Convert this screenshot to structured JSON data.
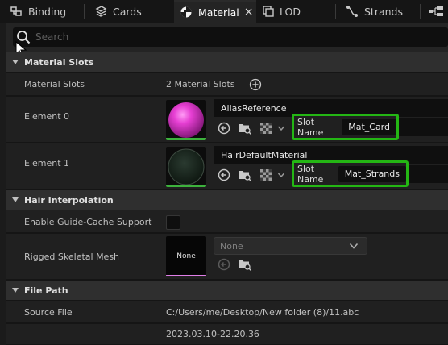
{
  "tabs": [
    {
      "label": "Binding",
      "icon": "binding-icon",
      "active": false
    },
    {
      "label": "Cards",
      "icon": "cards-icon",
      "active": false
    },
    {
      "label": "Material",
      "icon": "material-icon",
      "active": true,
      "close": "×"
    },
    {
      "label": "LOD",
      "icon": "lod-icon",
      "active": false
    },
    {
      "label": "Strands",
      "icon": "strands-icon",
      "active": false
    }
  ],
  "search": {
    "placeholder": "Search"
  },
  "material_slots": {
    "header": "Material Slots",
    "slots_label": "Material Slots",
    "slots_value": "2 Material Slots",
    "elements": [
      {
        "label": "Element 0",
        "material": "AliasReference",
        "slot_name_label": "Slot Name",
        "slot_name": "Mat_Card",
        "thumb_color": "#e63fd3",
        "bar_color": "#3db23d"
      },
      {
        "label": "Element 1",
        "material": "HairDefaultMaterial",
        "slot_name_label": "Slot Name",
        "slot_name": "Mat_Strands",
        "thumb_color": "#2a3a30",
        "bar_color": "#3db23d"
      }
    ]
  },
  "hair_interpolation": {
    "header": "Hair Interpolation",
    "guide_cache_label": "Enable Guide-Cache Support",
    "guide_cache_checked": false,
    "rigged_mesh_label": "Rigged Skeletal Mesh",
    "rigged_thumb_text": "None",
    "rigged_combo_value": "None"
  },
  "file_path": {
    "header": "File Path",
    "source_file_label": "Source File",
    "source_file_value": "C:/Users/me/Desktop/New folder (8)/11.abc",
    "timestamp": "2023.03.10-22.20.36"
  },
  "colors": {
    "accent_green": "#24b614",
    "panel": "#202020",
    "header": "#2f2f2f"
  }
}
